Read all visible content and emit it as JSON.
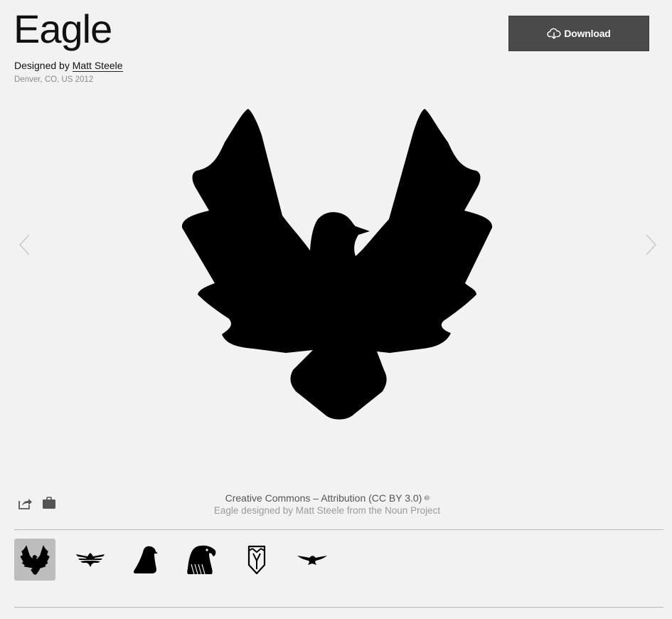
{
  "icon": {
    "title": "Eagle",
    "designed_by_prefix": "Designed by",
    "designer": "Matt Steele",
    "location_year": "Denver, CO, US 2012"
  },
  "toolbar": {
    "download_label": "Download"
  },
  "license": {
    "text": "Creative Commons – Attribution (CC BY 3.0)",
    "cc_symbol": "🅭",
    "attribution": "Eagle designed by Matt Steele from the Noun Project"
  },
  "actions": {
    "share_icon": "share-icon",
    "collection_icon": "briefcase-icon"
  },
  "navigation": {
    "prev_icon": "chevron-left-icon",
    "next_icon": "chevron-right-icon"
  },
  "related_icons": [
    {
      "name": "eagle-spread-wings",
      "selected": true
    },
    {
      "name": "eagle-emblem",
      "selected": false
    },
    {
      "name": "eagle-perched",
      "selected": false
    },
    {
      "name": "eagle-head",
      "selected": false
    },
    {
      "name": "eagle-shield",
      "selected": false
    },
    {
      "name": "eagle-flying",
      "selected": false
    }
  ],
  "colors": {
    "background": "#f2f2f2",
    "button": "#4a4a4a",
    "icon": "#000000",
    "selected_thumb": "#bdbdbd"
  }
}
